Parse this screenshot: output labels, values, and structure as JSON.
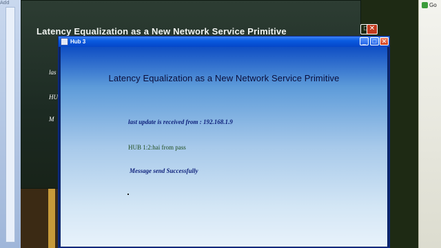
{
  "desktop": {
    "address_label": "Add",
    "go_label": "Go"
  },
  "back_window": {
    "title": "Latency Equalization as a New Network Service Primitive",
    "lines": [
      "las",
      "HU",
      "M"
    ]
  },
  "window": {
    "title": "Hub 3",
    "heading": "Latency Equalization as a New Network Service Primitive",
    "last_update": "last update is received from : 192.168.1.9",
    "hub_message": "HUB 1:2:hai from pass",
    "send_status": "Message send Successfully",
    "controls": {
      "minimize": "_",
      "maximize": "□",
      "close": "✕"
    }
  }
}
